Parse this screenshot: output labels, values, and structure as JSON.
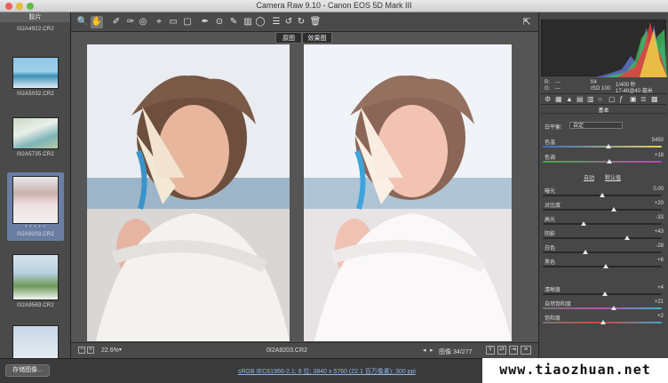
{
  "window": {
    "title": "Camera Raw 9.10 - Canon EOS 5D Mark III"
  },
  "filmstrip": {
    "header": "胶片",
    "items": [
      {
        "name": "0I2A4922.CR2"
      },
      {
        "name": "0I2A5032.CR2"
      },
      {
        "name": "0I2A5735.CR2"
      },
      {
        "name": "0I2A9203.CR2",
        "stars": "• • • • •",
        "selected": true
      },
      {
        "name": "0I2A9569.CR2"
      }
    ]
  },
  "viewer": {
    "before_label": "原图",
    "after_label": "效果图"
  },
  "bottombar": {
    "zoom": "22.6%",
    "filename": "0I2A9203.CR2",
    "image_counter": "图像 34/277"
  },
  "statusbar": {
    "save_label": "存储图像...",
    "workflow": "sRGB IEC61966-2.1; 8 位; 3840 x 5760 (22.1 百万像素); 300 ppi"
  },
  "panel": {
    "readout": {
      "r": "R:",
      "g": "G:",
      "b": "B:",
      "r_val": "---",
      "g_val": "---",
      "b_val": "---",
      "aperture": "f/4",
      "shutter": "1/400 秒",
      "iso": "ISO 100",
      "lens": "17-40@40 毫米"
    },
    "section": "基本",
    "wb_label": "白平衡:",
    "wb_value": "自定",
    "auto": "自动",
    "default": "默认值",
    "sliders": [
      {
        "label": "色温",
        "value": "5450",
        "pos": 0.55
      },
      {
        "label": "色调",
        "value": "+18",
        "pos": 0.56
      },
      {
        "label": "曝光",
        "value": "0.00",
        "pos": 0.5
      },
      {
        "label": "对比度",
        "value": "+20",
        "pos": 0.6
      },
      {
        "label": "高光",
        "value": "-33",
        "pos": 0.34
      },
      {
        "label": "阴影",
        "value": "+43",
        "pos": 0.71
      },
      {
        "label": "白色",
        "value": "-28",
        "pos": 0.36
      },
      {
        "label": "黑色",
        "value": "+6",
        "pos": 0.53
      },
      {
        "label": "清晰度",
        "value": "+4",
        "pos": 0.52
      },
      {
        "label": "自然饱和度",
        "value": "+21",
        "pos": 0.6
      },
      {
        "label": "饱和度",
        "value": "+2",
        "pos": 0.51
      }
    ]
  },
  "watermark": "www.tiaozhuan.net",
  "colors": {
    "accent": "#6a7ea3",
    "panel": "#474747"
  }
}
